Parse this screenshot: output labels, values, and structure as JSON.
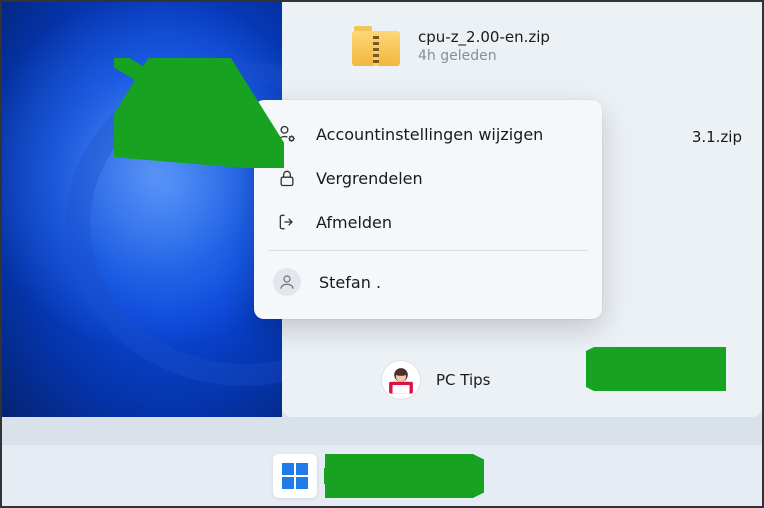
{
  "file": {
    "name": "cpu-z_2.00-en.zip",
    "time": "4h geleden"
  },
  "truncated_file": "3.1.zip",
  "menu": {
    "account_settings": "Accountinstellingen wijzigen",
    "lock": "Vergrendelen",
    "sign_out": "Afmelden",
    "other_user": "Stefan ."
  },
  "current_user": "PC Tips",
  "colors": {
    "accent": "#1f7be8",
    "arrow": "#17a321"
  }
}
